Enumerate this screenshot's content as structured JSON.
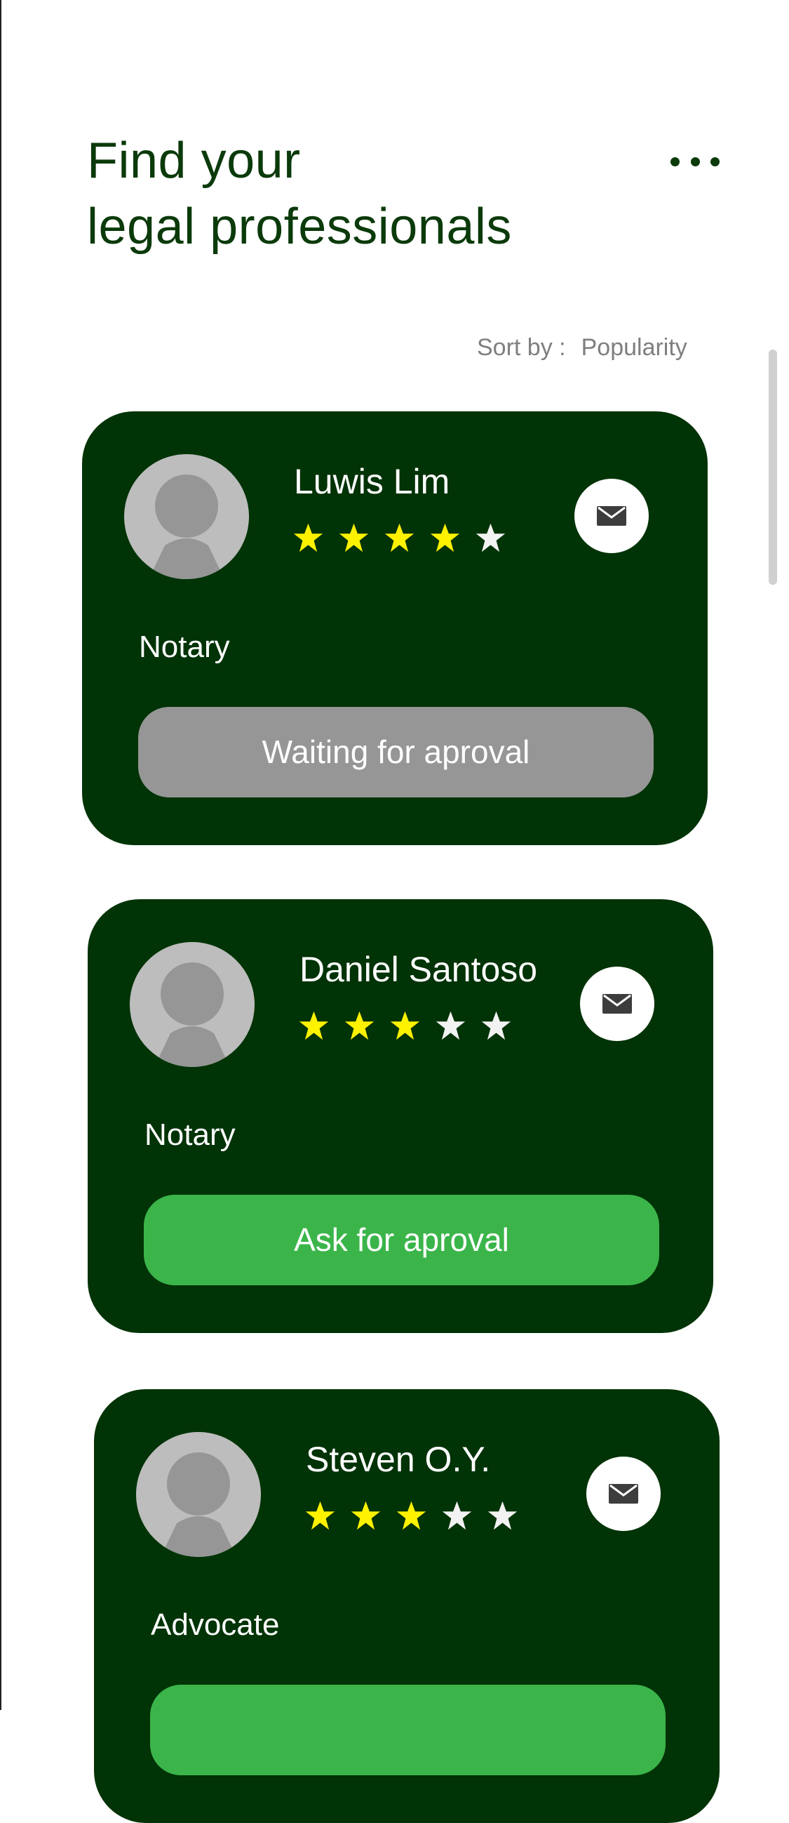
{
  "header": {
    "title_line_1": "Find your",
    "title_line_2": "legal professionals",
    "more_icon": "more-horizontal-icon"
  },
  "sort": {
    "label": "Sort by :",
    "value": "Popularity"
  },
  "colors": {
    "header_text": "#0b3a0b",
    "card_background": "#003306",
    "filled_star": "#fff200",
    "empty_star": "#f2f2f2",
    "waiting_button": "#969696",
    "approval_button": "#3bb54a"
  },
  "cards": [
    {
      "name": "Luwis Lim",
      "rating": 4,
      "max_rating": 5,
      "role": "Notary",
      "button_label": "Waiting for aproval",
      "button_state": "waiting",
      "mail_icon": "mail-icon",
      "avatar_icon": "avatar-placeholder-icon"
    },
    {
      "name": "Daniel Santoso",
      "rating": 3,
      "max_rating": 5,
      "role": "Notary",
      "button_label": "Ask for aproval",
      "button_state": "available",
      "mail_icon": "mail-icon",
      "avatar_icon": "avatar-placeholder-icon"
    },
    {
      "name": "Steven O.Y.",
      "rating": 3,
      "max_rating": 5,
      "role": "Advocate",
      "button_label": "",
      "button_state": "available",
      "mail_icon": "mail-icon",
      "avatar_icon": "avatar-placeholder-icon"
    }
  ]
}
